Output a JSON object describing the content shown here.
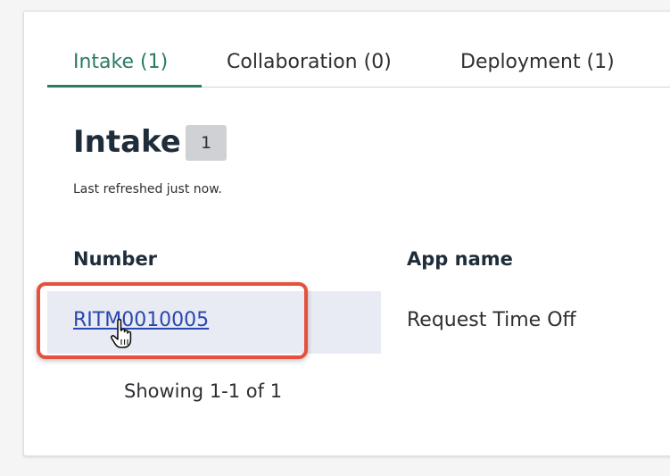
{
  "tabs": [
    {
      "label": "Intake (1)",
      "active": true
    },
    {
      "label": "Collaboration (0)",
      "active": false
    },
    {
      "label": "Deployment (1)",
      "active": false
    }
  ],
  "section": {
    "title": "Intake",
    "count": "1",
    "last_refreshed": "Last refreshed just now."
  },
  "table": {
    "headers": [
      "Number",
      "App name"
    ],
    "rows": [
      {
        "number": "RITM0010005",
        "app_name": "Request Time Off"
      }
    ]
  },
  "pagination": {
    "summary": "Showing 1-1 of 1"
  },
  "colors": {
    "accent": "#2b7a66",
    "link": "#2947b0",
    "highlight": "#e5513d"
  },
  "icons": {
    "cursor": "hand-pointer-icon"
  }
}
